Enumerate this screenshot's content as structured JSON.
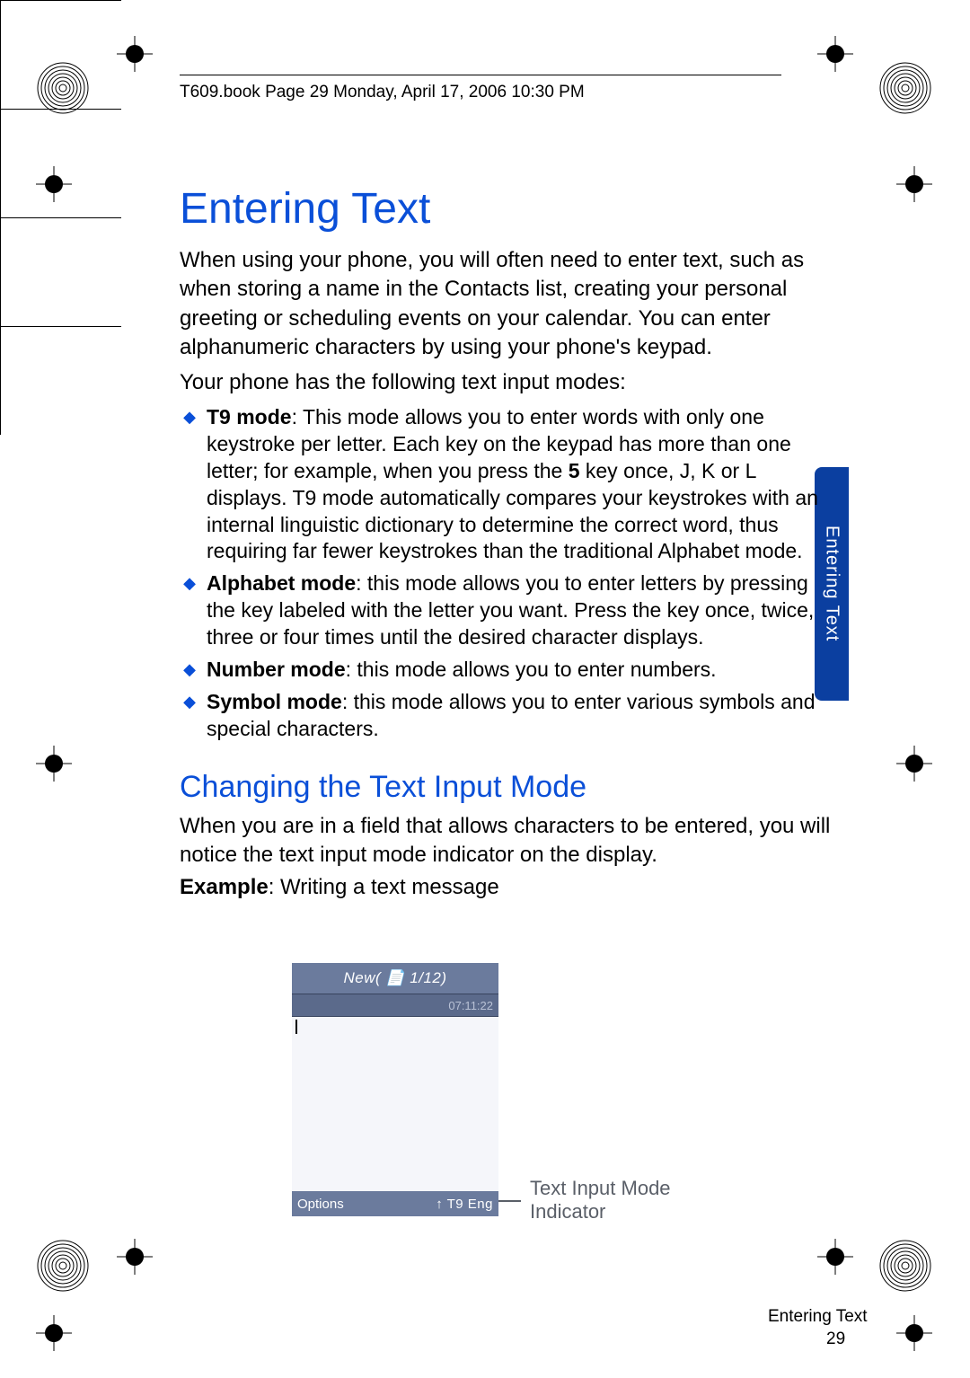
{
  "header": {
    "running_header": "T609.book  Page 29  Monday, April 17, 2006  10:30 PM"
  },
  "title": "Entering Text",
  "intro_p1": "When using your phone, you will often need to enter text, such as when storing a name in the Contacts list, creating your personal greeting or scheduling events on your calendar. You can enter alphanumeric characters by using your phone's keypad.",
  "intro_p2": "Your phone has the following text input modes:",
  "bullets": [
    {
      "label": "T9 mode",
      "rest": ": This mode allows you to enter words with only one keystroke per letter. Each key on the keypad has more than one letter; for example, when you press the ",
      "boldmid": "5",
      "rest2": " key once, J, K or L displays. T9 mode automatically compares your keystrokes with an internal linguistic dictionary to determine the correct word, thus requiring far fewer keystrokes than the traditional Alphabet mode."
    },
    {
      "label": "Alphabet mode",
      "rest": ": this mode allows you to enter letters by pressing the key labeled with the letter you want. Press the key once, twice, three or four times until the desired character displays."
    },
    {
      "label": "Number mode",
      "rest": ": this mode allows you to enter numbers."
    },
    {
      "label": "Symbol mode",
      "rest": ": this mode allows you to enter various symbols and special characters."
    }
  ],
  "h2": "Changing the Text Input Mode",
  "h2_p": "When you are in a field that allows characters to be entered, you will notice the text input mode indicator on the display.",
  "example_label": "Example",
  "example_rest": ": Writing a text message",
  "screenshot": {
    "title": "New( 📄 1/12)",
    "row2_left": "",
    "row2_right": "07:11:22",
    "bottom_left": "Options",
    "bottom_right": "↑ T9 Eng"
  },
  "callout_l1": "Text Input Mode",
  "callout_l2": "Indicator",
  "side_tab": "Entering Text",
  "footer_section": "Entering Text",
  "footer_page": "29"
}
